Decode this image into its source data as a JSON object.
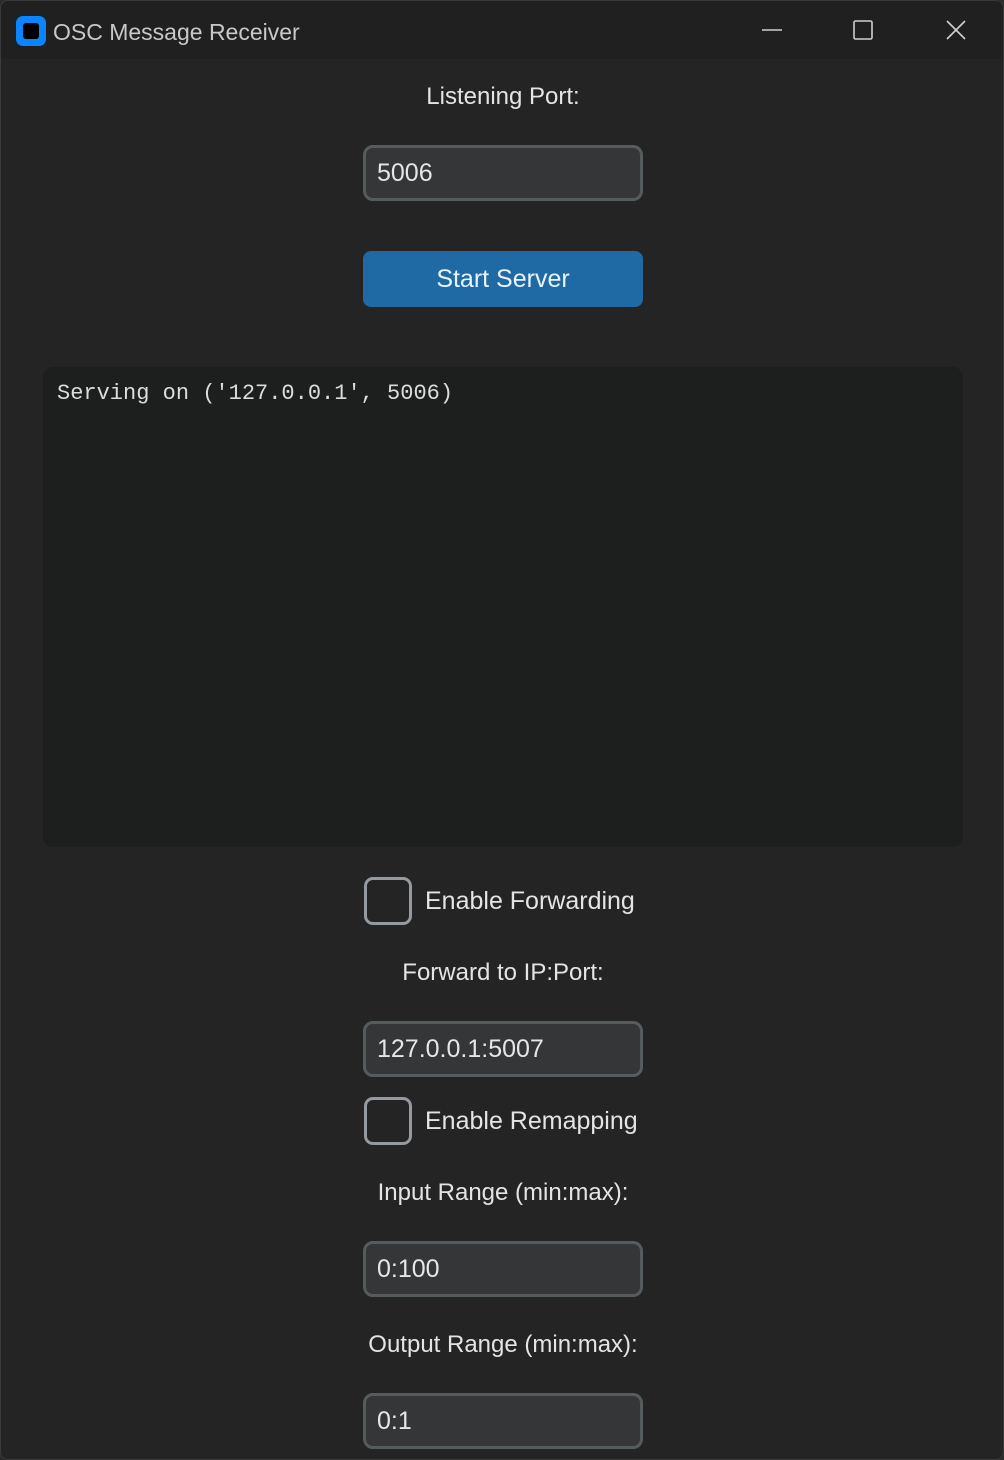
{
  "window": {
    "title": "OSC Message Receiver",
    "icon": "app-icon",
    "controls": [
      "minimize-icon",
      "maximize-icon",
      "close-icon"
    ]
  },
  "server": {
    "port_label": "Listening Port:",
    "port_value": "5006",
    "start_button": "Start Server"
  },
  "log": {
    "text": "Serving on ('127.0.0.1', 5006)"
  },
  "forwarding": {
    "enable_label": "Enable Forwarding",
    "checked": false,
    "target_label": "Forward to IP:Port:",
    "target_value": "127.0.0.1:5007"
  },
  "remapping": {
    "enable_label": "Enable Remapping",
    "checked": false,
    "input_label": "Input Range (min:max):",
    "input_value": "0:100",
    "output_label": "Output Range (min:max):",
    "output_value": "0:1"
  },
  "colors": {
    "accent": "#1f6aa5",
    "app_icon": "#0a84ff",
    "window_bg": "#242424",
    "entry_bg": "#343638",
    "entry_border": "#565b5e",
    "checkbox_border": "#949a9f"
  }
}
